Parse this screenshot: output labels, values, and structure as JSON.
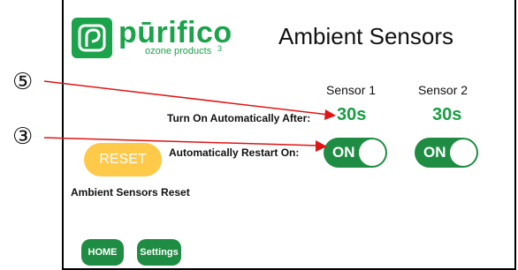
{
  "app": {
    "brand": "pūrifico",
    "brand_sub": "ozone products",
    "brand_mark": "3",
    "title": "Ambient Sensors"
  },
  "sensors": [
    {
      "name": "Sensor 1",
      "turn_on_after": "30s",
      "restart": "ON"
    },
    {
      "name": "Sensor 2",
      "turn_on_after": "30s",
      "restart": "ON"
    }
  ],
  "labels": {
    "turn_on": "Turn On Automatically After:",
    "restart": "Automatically Restart On:",
    "reset_caption": "Ambient Sensors Reset"
  },
  "buttons": {
    "reset": "RESET",
    "home": "HOME",
    "settings": "Settings"
  },
  "callouts": {
    "top": "⑤",
    "bottom": "③"
  },
  "colors": {
    "accent": "#1aa34a",
    "toggle_on": "#1e8c42",
    "reset_button": "#ffc94a",
    "arrow": "#e01515"
  }
}
